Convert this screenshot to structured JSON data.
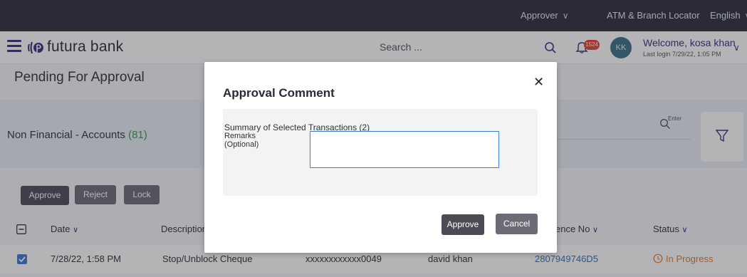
{
  "topbar": {
    "approver_label": "Approver",
    "locator_label": "ATM & Branch Locator",
    "language_label": "English"
  },
  "header": {
    "brand_name": "futura bank",
    "search_placeholder": "Search ...",
    "notification_count": "1524",
    "avatar_initials": "KK",
    "welcome_text": "Welcome, kosa khan",
    "last_login": "Last login 7/29/22, 1:05 PM"
  },
  "page": {
    "title": "Pending For Approval",
    "category_label": "Non Financial - Accounts",
    "category_count": "(81)",
    "search_hint": "Enter"
  },
  "actions": {
    "approve": "Approve",
    "reject": "Reject",
    "lock": "Lock"
  },
  "table": {
    "columns": [
      "Date",
      "Description",
      "Reference No",
      "Status"
    ],
    "visible_column_fragments": {
      "reference_no": "ence No"
    },
    "rows": [
      {
        "date": "7/28/22, 1:58 PM",
        "description": "Stop/Unblock Cheque",
        "account": "xxxxxxxxxxxx0049",
        "initiated_by": "david khan",
        "reference_no": "2807949746D5",
        "status": "In Progress"
      }
    ]
  },
  "modal": {
    "title": "Approval Comment",
    "summary": "Summary of Selected Transactions (2)",
    "remarks_label": "Remarks",
    "remarks_optional": "(Optional)",
    "remarks_value": "",
    "approve_button": "Approve",
    "cancel_button": "Cancel"
  },
  "colors": {
    "topbar_bg": "#2b2d3a",
    "brand_purple": "#3b2f7a",
    "count_green": "#2e9b5a",
    "link_blue": "#2f6fb3",
    "status_orange": "#e07a2c",
    "badge_red": "#e8412c",
    "checkbox_blue": "#3a7bd5"
  }
}
